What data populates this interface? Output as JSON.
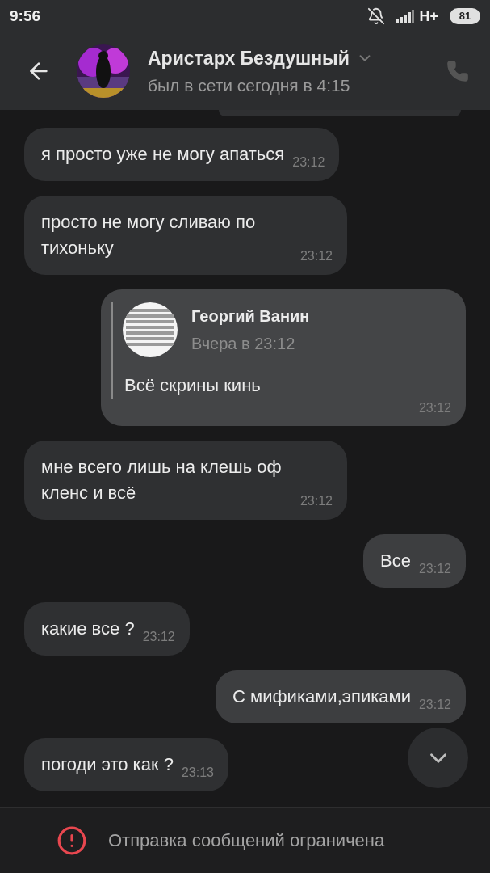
{
  "status_bar": {
    "time": "9:56",
    "network": "H+",
    "battery": "81"
  },
  "header": {
    "name": "Аристарх Бездушный",
    "status": "был в сети сегодня в 4:15"
  },
  "messages": [
    {
      "kind": "text",
      "outgoing": false,
      "text": "я просто уже не могу апаться",
      "time": "23:12"
    },
    {
      "kind": "text",
      "outgoing": false,
      "text": "просто не могу сливаю по тихоньку",
      "time": "23:12"
    },
    {
      "kind": "quote",
      "outgoing": true,
      "quote_author": "Георгий Ванин",
      "quote_date": "Вчера в 23:12",
      "text": "Всё скрины кинь",
      "time": "23:12"
    },
    {
      "kind": "text",
      "outgoing": false,
      "text": "мне всего лишь на клешь оф кленс и всё",
      "time": "23:12"
    },
    {
      "kind": "text",
      "outgoing": true,
      "text": "Все",
      "time": "23:12"
    },
    {
      "kind": "text",
      "outgoing": false,
      "text": "какие все ?",
      "time": "23:12"
    },
    {
      "kind": "text",
      "outgoing": true,
      "text": "С мификами,эпиками",
      "time": "23:12"
    },
    {
      "kind": "text",
      "outgoing": false,
      "text": "погоди это как ?",
      "time": "23:13"
    }
  ],
  "footer": {
    "notice": "Отправка сообщений ограничена"
  }
}
